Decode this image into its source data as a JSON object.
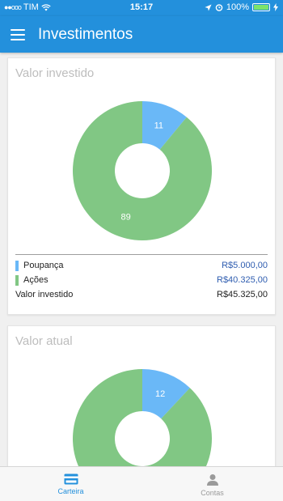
{
  "status_bar": {
    "signal": "●●ooo",
    "carrier": "TIM",
    "time": "15:17",
    "battery": "100%"
  },
  "app_bar": {
    "title": "Investimentos"
  },
  "cards": [
    {
      "title": "Valor investido",
      "chart_data": {
        "type": "pie",
        "labels": [
          "Poupança",
          "Ações"
        ],
        "values": [
          11,
          89
        ],
        "donut": true,
        "colors": [
          "#6ab8f7",
          "#81c784"
        ]
      },
      "legend": [
        {
          "label": "Poupança",
          "value": "R$5.000,00",
          "color": "#6ab8f7"
        },
        {
          "label": "Ações",
          "value": "R$40.325,00",
          "color": "#81c784"
        }
      ],
      "total": {
        "label": "Valor investido",
        "value": "R$45.325,00"
      }
    },
    {
      "title": "Valor atual",
      "chart_data": {
        "type": "pie",
        "labels": [
          "Poupança",
          "Ações"
        ],
        "values": [
          12,
          88
        ],
        "donut": true,
        "colors": [
          "#6ab8f7",
          "#81c784"
        ]
      }
    }
  ],
  "tab_bar": {
    "items": [
      {
        "label": "Carteira",
        "icon": "wallet-card-icon",
        "active": true
      },
      {
        "label": "Contas",
        "icon": "person-icon",
        "active": false
      }
    ]
  },
  "colors": {
    "primary": "#2390dc",
    "poupanca": "#6ab8f7",
    "acoes": "#81c784"
  }
}
